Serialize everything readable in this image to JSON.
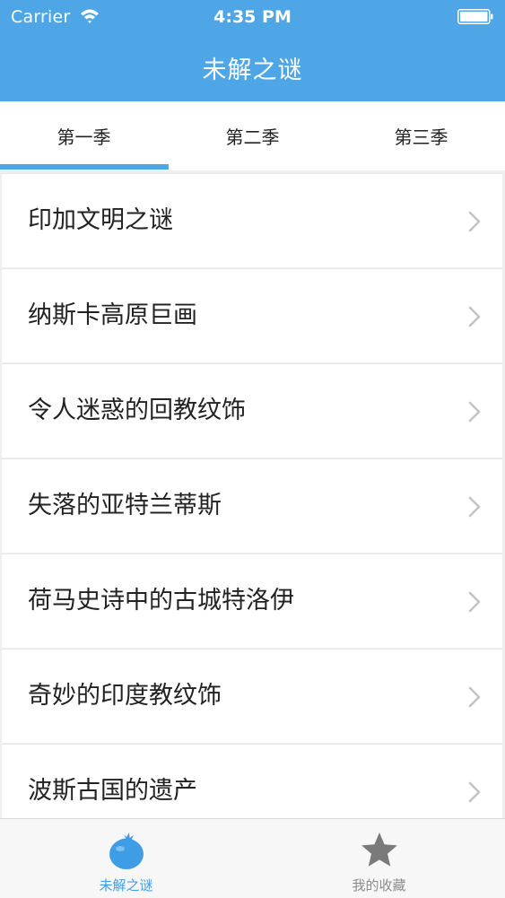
{
  "status_bar": {
    "carrier": "Carrier",
    "time": "4:35 PM",
    "wifi_icon": "wifi-icon",
    "battery_icon": "battery-icon"
  },
  "nav": {
    "title": "未解之谜"
  },
  "tabs": [
    {
      "label": "第一季",
      "selected": true
    },
    {
      "label": "第二季",
      "selected": false
    },
    {
      "label": "第三季",
      "selected": false
    }
  ],
  "list": {
    "items": [
      {
        "label": "印加文明之谜"
      },
      {
        "label": "纳斯卡高原巨画"
      },
      {
        "label": "令人迷惑的回教纹饰"
      },
      {
        "label": "失落的亚特兰蒂斯"
      },
      {
        "label": "荷马史诗中的古城特洛伊"
      },
      {
        "label": "奇妙的印度教纹饰"
      },
      {
        "label": "波斯古国的遗产"
      }
    ],
    "chevron_icon": "chevron-right-icon"
  },
  "tabbar": {
    "items": [
      {
        "label": "未解之谜",
        "icon": "tomato-icon",
        "selected": true
      },
      {
        "label": "我的收藏",
        "icon": "star-icon",
        "selected": false
      }
    ]
  },
  "colors": {
    "accent": "#4ea6e6",
    "tab_active_label": "#3f9de5",
    "tab_inactive_label": "#8c8c8c",
    "star_icon": "#7a7a7a"
  }
}
